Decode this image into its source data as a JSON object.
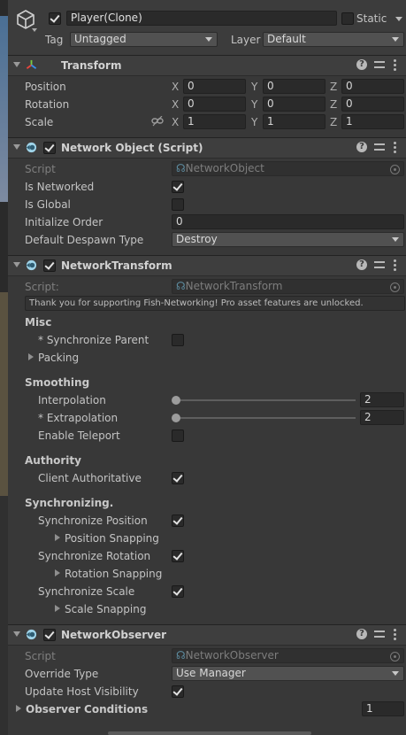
{
  "header": {
    "object_name": "Player(Clone)",
    "static_label": "Static",
    "tag_label": "Tag",
    "tag_value": "Untagged",
    "layer_label": "Layer",
    "layer_value": "Default"
  },
  "transform": {
    "title": "Transform",
    "position_label": "Position",
    "rotation_label": "Rotation",
    "scale_label": "Scale",
    "axis_x": "X",
    "axis_y": "Y",
    "axis_z": "Z",
    "position": {
      "x": "0",
      "y": "0",
      "z": "0"
    },
    "rotation": {
      "x": "0",
      "y": "0",
      "z": "0"
    },
    "scale": {
      "x": "1",
      "y": "1",
      "z": "1"
    }
  },
  "network_object": {
    "title": "Network Object (Script)",
    "script_label": "Script",
    "script_value": "NetworkObject",
    "is_networked_label": "Is Networked",
    "is_global_label": "Is Global",
    "initialize_order_label": "Initialize Order",
    "initialize_order_value": "0",
    "despawn_type_label": "Default Despawn Type",
    "despawn_type_value": "Destroy"
  },
  "network_transform": {
    "title": "NetworkTransform",
    "script_label": "Script:",
    "script_value": "NetworkTransform",
    "info": "Thank you for supporting Fish-Networking! Pro asset features are unlocked.",
    "misc_label": "Misc",
    "sync_parent_label": "* Synchronize Parent",
    "packing_label": "Packing",
    "smoothing_label": "Smoothing",
    "interpolation_label": "Interpolation",
    "interpolation_value": "2",
    "extrapolation_label": "* Extrapolation",
    "extrapolation_value": "2",
    "enable_teleport_label": "Enable Teleport",
    "authority_label": "Authority",
    "client_auth_label": "Client Authoritative",
    "synchronizing_label": "Synchronizing.",
    "sync_position_label": "Synchronize Position",
    "position_snapping_label": "Position Snapping",
    "sync_rotation_label": "Synchronize Rotation",
    "rotation_snapping_label": "Rotation Snapping",
    "sync_scale_label": "Synchronize Scale",
    "scale_snapping_label": "Scale Snapping"
  },
  "network_observer": {
    "title": "NetworkObserver",
    "script_label": "Script",
    "script_value": "NetworkObserver",
    "override_type_label": "Override Type",
    "override_type_value": "Use Manager",
    "update_host_label": "Update Host Visibility",
    "observer_conditions_label": "Observer Conditions",
    "observer_conditions_value": "1"
  },
  "icons": {
    "help": "?"
  }
}
